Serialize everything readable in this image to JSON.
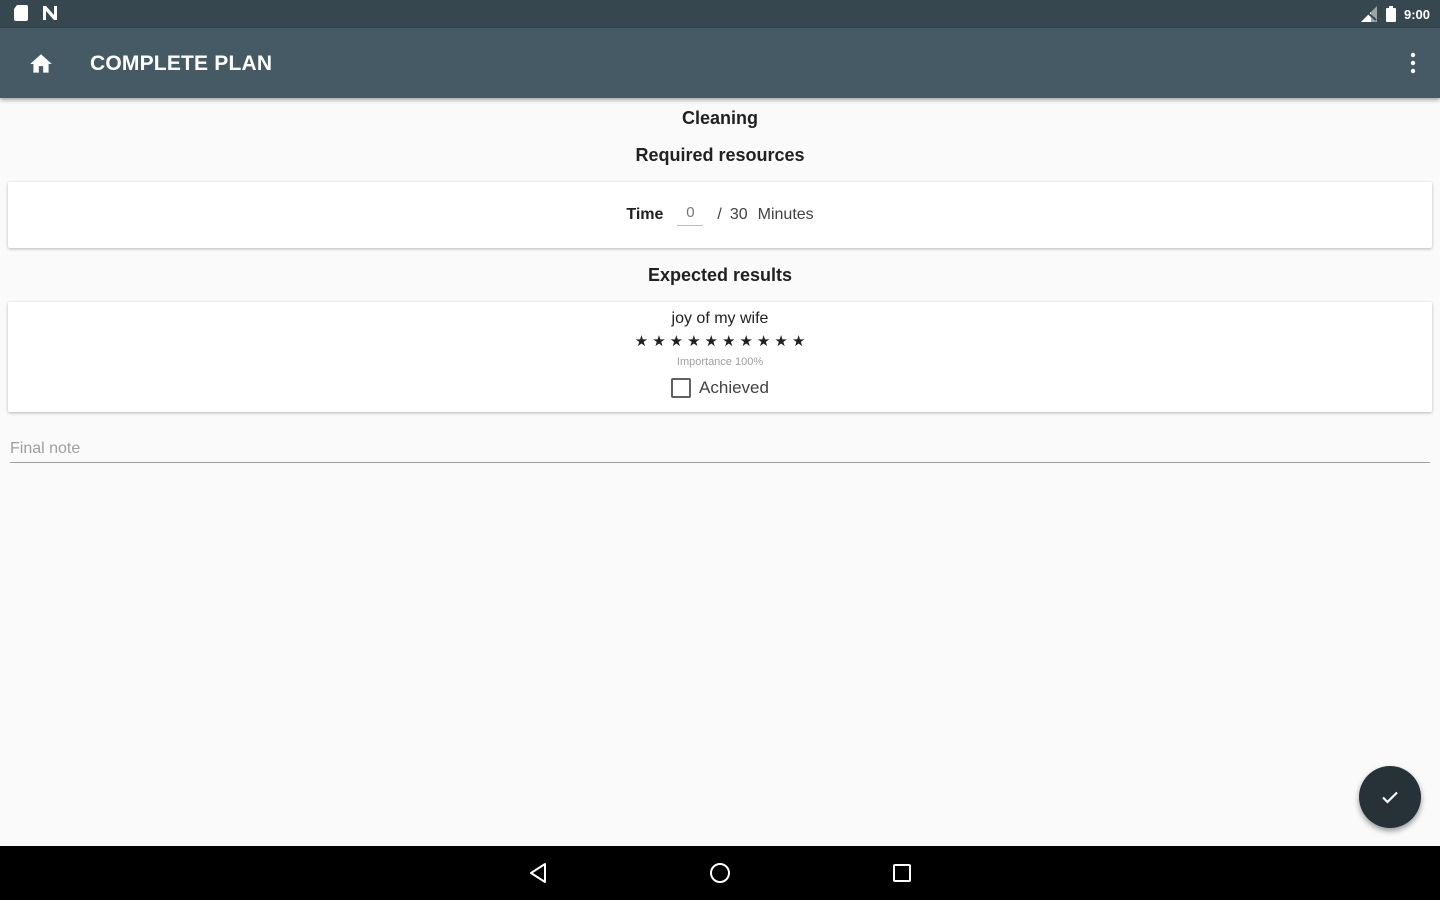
{
  "status_bar": {
    "time": "9:00",
    "left_icons": [
      "sd-card-icon",
      "notification-n-icon"
    ],
    "right_icons": [
      "signal-icon",
      "battery-icon"
    ]
  },
  "app_bar": {
    "title": "COMPLETE PLAN",
    "home_icon": "home-icon",
    "menu_icon": "more-vert-icon"
  },
  "plan": {
    "title": "Cleaning"
  },
  "resources": {
    "heading": "Required resources",
    "time": {
      "label": "Time",
      "value": "",
      "placeholder": "0",
      "separator": "/",
      "total": "30",
      "unit": "Minutes"
    }
  },
  "results": {
    "heading": "Expected results",
    "items": [
      {
        "name": "joy of my wife",
        "rating": 10,
        "max_rating": 10,
        "importance_label": "Importance 100%",
        "achieved_label": "Achieved",
        "achieved": false
      }
    ]
  },
  "final_note": {
    "placeholder": "Final note",
    "value": ""
  },
  "fab": {
    "icon": "check-icon"
  },
  "nav_bar": {
    "icons": [
      "back-icon",
      "home-circle-icon",
      "recents-icon"
    ]
  },
  "colors": {
    "status_bar": "#37474f",
    "app_bar": "#455a64",
    "fab": "#263238",
    "background": "#fafafa"
  }
}
